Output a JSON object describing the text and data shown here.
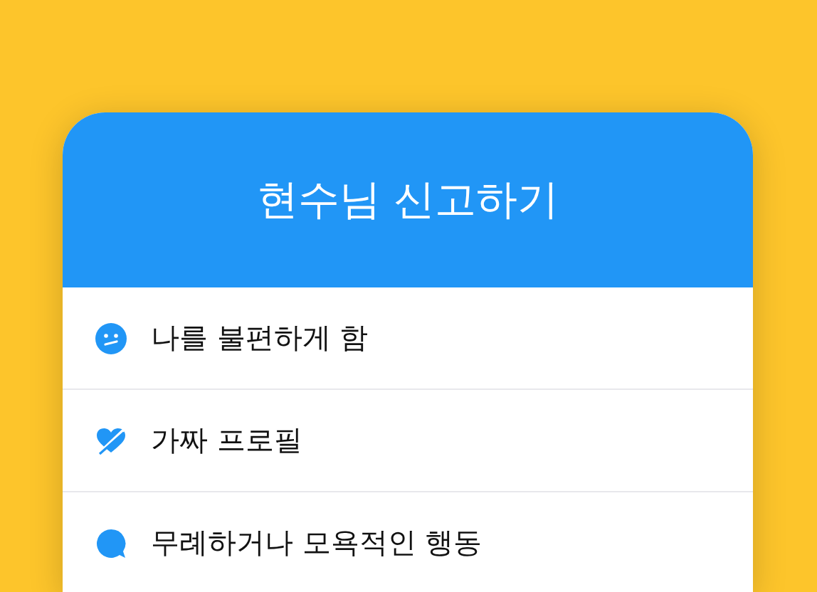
{
  "dialog": {
    "title": "현수님 신고하기"
  },
  "options": [
    {
      "kind": "face",
      "label": "나를 불편하게 함"
    },
    {
      "kind": "heart",
      "label": "가짜 프로필"
    },
    {
      "kind": "bubble",
      "label": "무례하거나 모욕적인 행동"
    }
  ]
}
